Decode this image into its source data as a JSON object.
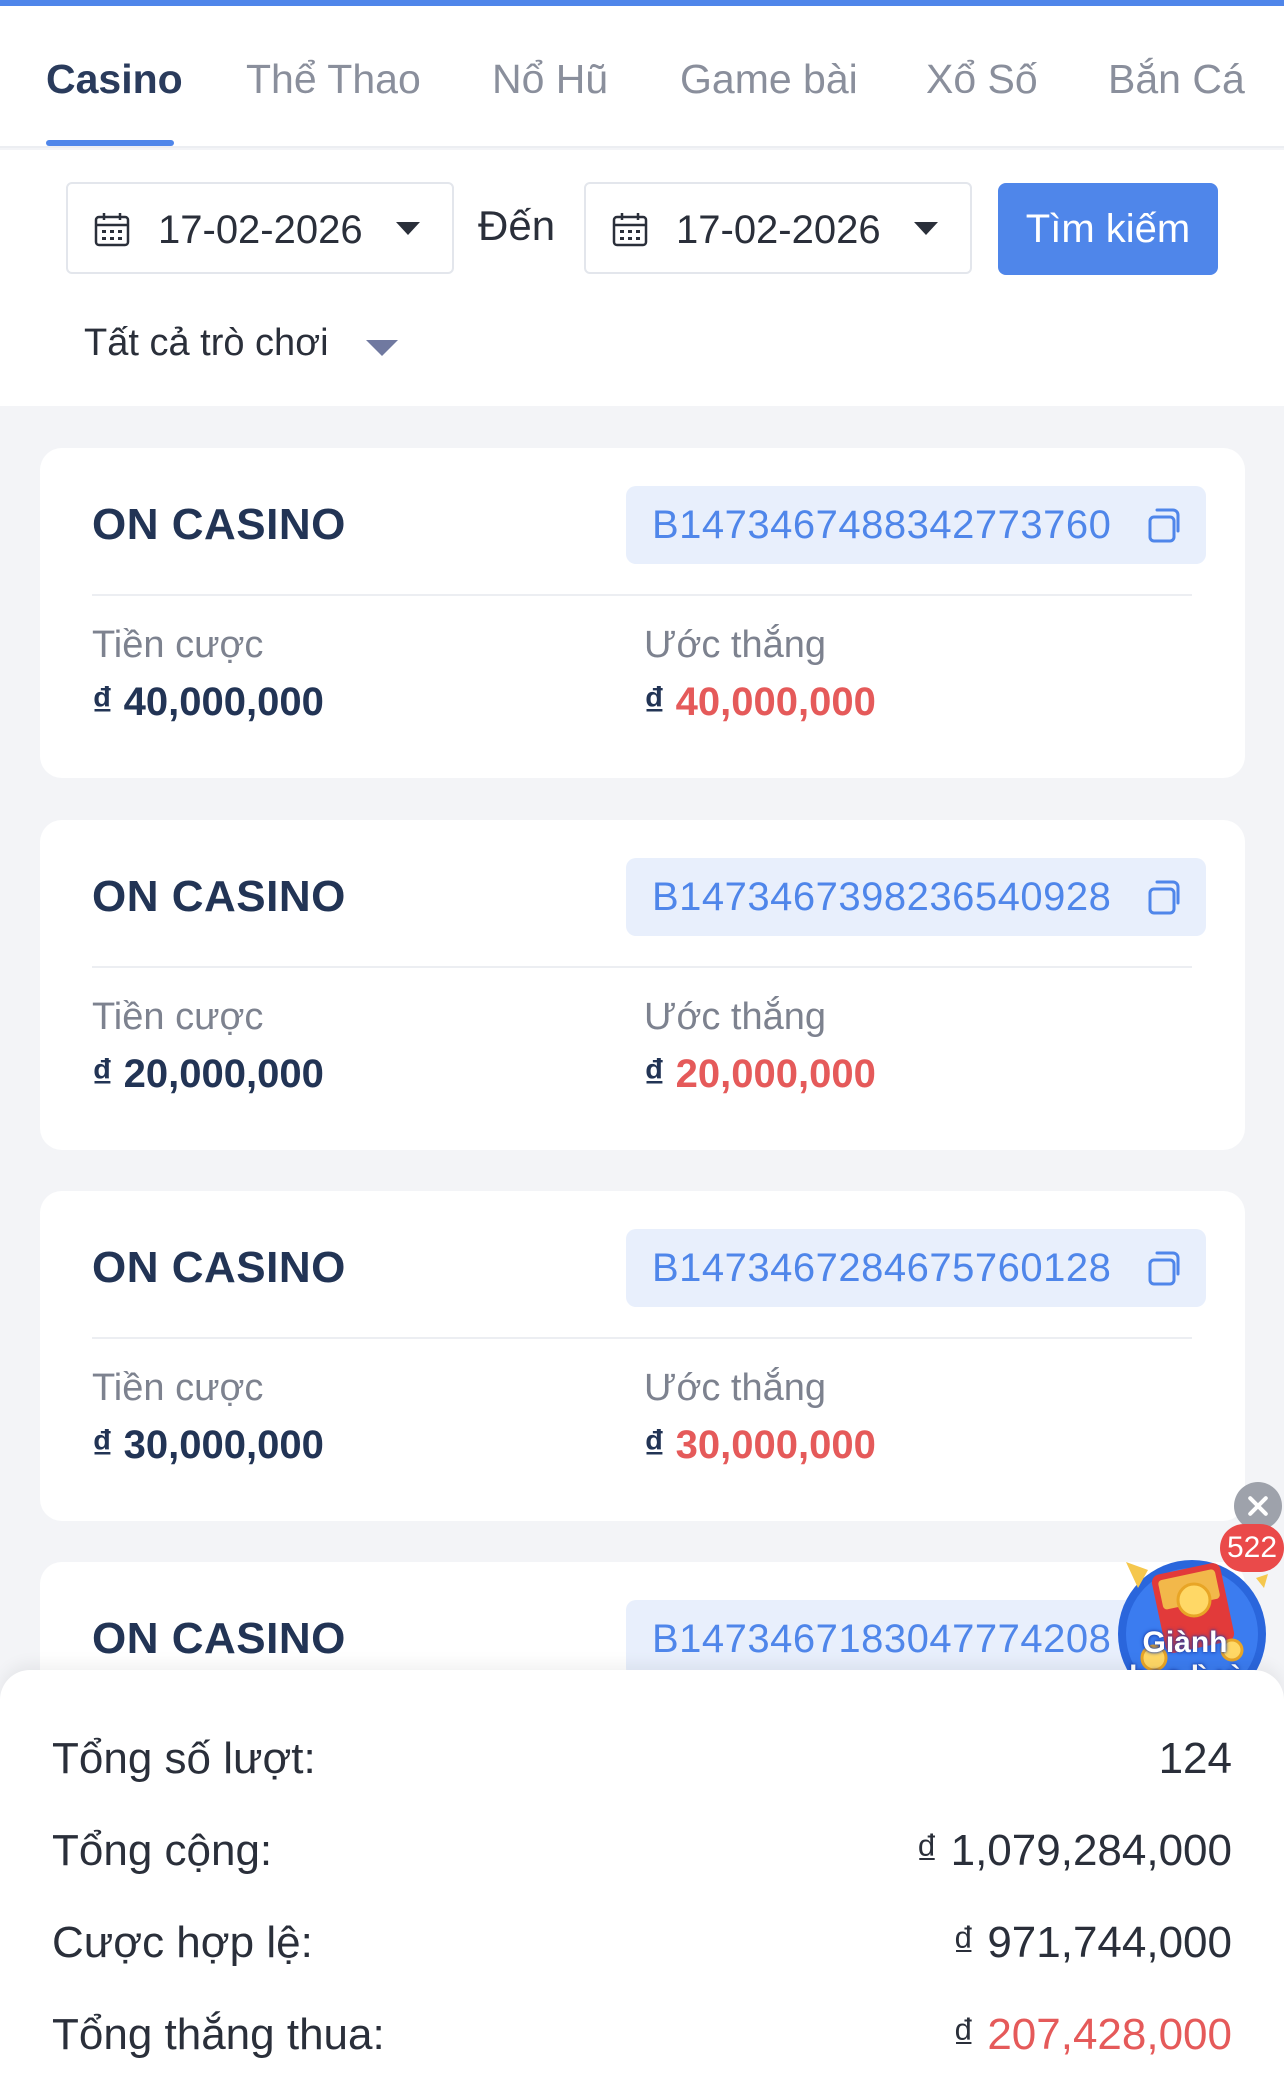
{
  "tabs": [
    {
      "label": "Casino",
      "active": true
    },
    {
      "label": "Thể Thao",
      "active": false
    },
    {
      "label": "Nổ Hũ",
      "active": false
    },
    {
      "label": "Game bài",
      "active": false
    },
    {
      "label": "Xổ Số",
      "active": false
    },
    {
      "label": "Bắn Cá",
      "active": false
    }
  ],
  "filters": {
    "from_date": "17-02-2026",
    "to_label": "Đến",
    "to_date": "17-02-2026",
    "search_label": "Tìm kiếm",
    "game_filter": "Tất cả trò chơi"
  },
  "cards": [
    {
      "title": "ON CASINO",
      "id": "B1473467488342773760",
      "bet_label": "Tiền cược",
      "bet_currency": "₫",
      "bet_amount": "40,000,000",
      "win_label": "Ước thắng",
      "win_currency": "₫",
      "win_amount": "40,000,000"
    },
    {
      "title": "ON CASINO",
      "id": "B1473467398236540928",
      "bet_label": "Tiền cược",
      "bet_currency": "₫",
      "bet_amount": "20,000,000",
      "win_label": "Ước thắng",
      "win_currency": "₫",
      "win_amount": "20,000,000"
    },
    {
      "title": "ON CASINO",
      "id": "B1473467284675760128",
      "bet_label": "Tiền cược",
      "bet_currency": "₫",
      "bet_amount": "30,000,000",
      "win_label": "Ước thắng",
      "win_currency": "₫",
      "win_amount": "30,000,000"
    },
    {
      "title": "ON CASINO",
      "id": "B1473467183047774208"
    }
  ],
  "promo": {
    "badge_count": "522",
    "text_line1": "Giành",
    "text_line2": "bao lì xì"
  },
  "summary": {
    "total_turns_label": "Tổng số lượt:",
    "total_turns_value": "124",
    "total_label": "Tổng cộng:",
    "total_currency": "₫",
    "total_value": "1,079,284,000",
    "valid_bet_label": "Cược hợp lệ:",
    "valid_bet_currency": "₫",
    "valid_bet_value": "971,744,000",
    "win_loss_label": "Tổng thắng thua:",
    "win_loss_currency": "₫",
    "win_loss_value": "207,428,000"
  },
  "colors": {
    "accent": "#4f86ea",
    "win_red": "#e55a5a",
    "title_navy": "#223455"
  }
}
